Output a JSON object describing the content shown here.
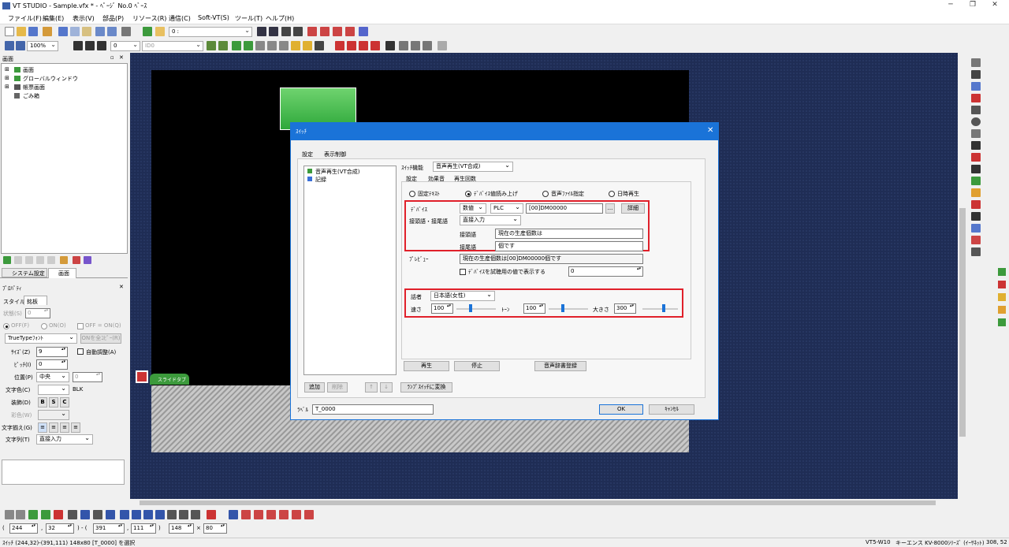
{
  "app": {
    "title": "VT STUDIO - Sample.vfx * - ﾍﾟｰｼﾞ No.0 ﾍﾞｰｽ"
  },
  "menu": [
    "ファイル(F)",
    "編集(E)",
    "表示(V)",
    "部品(P)",
    "リソース(R)",
    "通信(C)",
    "Soft-VT(S)",
    "ツール(T)",
    "ヘルプ(H)"
  ],
  "toolbar": {
    "page_combo": "0 :",
    "zoom": "100%",
    "zoom_combo2": "0",
    "id_combo": "ID0"
  },
  "screen_panel": {
    "title": "画面",
    "tree": [
      "画面",
      "グローバルウィンドウ",
      "帳票画面",
      "ごみ箱"
    ],
    "tabs": [
      "システム設定",
      "画面"
    ]
  },
  "property_panel": {
    "title": "ﾌﾟﾛﾊﾟﾃｨ",
    "tabs": [
      "スタイル",
      "銘板"
    ],
    "state_label": "状態(S)",
    "state_value": "0",
    "radio_off": "OFF(F)",
    "radio_on": "ON(O)",
    "check_off_on": "OFF = ON(Q)",
    "font_combo": "TrueTypeﾌｫﾝﾄ",
    "on_copy_btn": "ONを全ｺﾋﾟｰ(R)",
    "size_label": "ｻｲｽﾞ(Z)",
    "size_value": "9",
    "auto_adjust": "自動調整(A)",
    "pitch_label": "ﾋﾟｯﾁ(I)",
    "pitch_value": "0",
    "position_label": "位置(P)",
    "position_value": "中央",
    "position_value2": "0",
    "text_color_label": "文字色(C)",
    "blk": "BLK",
    "decoration_label": "装飾(D)",
    "deco_b": "B",
    "deco_s": "S",
    "deco_c": "C",
    "color_label": "彩色(W)",
    "align_label": "文字揃え(G)",
    "text_row_label": "文字列(T)",
    "text_row_value": "直接入力"
  },
  "canvas": {
    "slide_tab": "スライドタブ"
  },
  "dialog": {
    "title": "ｽｲｯﾁ",
    "tabs": [
      "設定",
      "表示制御"
    ],
    "function_list": [
      "音声再生(VT合成)",
      "記録"
    ],
    "add_btn": "追加",
    "delete_btn": "削除",
    "up_btn": "↑",
    "down_btn": "↓",
    "lamp_convert_btn": "ﾗﾝﾌﾟｽｲｯﾁに変換",
    "label_label": "ﾗﾍﾞﾙ",
    "label_value": "T_0000",
    "ok": "OK",
    "cancel": "ｷｬﾝｾﾙ",
    "switch_func_label": "ｽｲｯﾁ機能",
    "switch_func_value": "音声再生(VT合成)",
    "sub_tabs": [
      "設定",
      "効果音",
      "再生回数"
    ],
    "radios": [
      "固定ﾃｷｽﾄ",
      "ﾃﾞﾊﾞｲｽ値読み上げ",
      "音声ﾌｧｲﾙ指定",
      "日時再生"
    ],
    "device_label": "ﾃﾞﾊﾞｲｽ",
    "device_type": "数値",
    "device_plc": "PLC",
    "device_addr": "[00]DM00000",
    "device_more": "...",
    "detail_btn": "詳細",
    "prefix_suffix_label": "接頭語・接尾語",
    "prefix_suffix_mode": "直接入力",
    "prefix_label": "接頭語",
    "prefix_value": "現在の生産個数は",
    "suffix_label": "接尾語",
    "suffix_value": "個です",
    "preview_label": "ﾌﾟﾚﾋﾞｭｰ",
    "preview_value": "現在の生産個数は[00]DM00000個です",
    "trial_check": "ﾃﾞﾊﾞｲｽを試聴用の値で表示する",
    "trial_value": "0",
    "speaker_label": "話者",
    "speaker_value": "日本語(女性)",
    "speed_label": "速さ",
    "speed_value": "100",
    "tone_label": "ﾄｰﾝ",
    "tone_value": "100",
    "volume_label": "大きさ",
    "volume_value": "300",
    "speed_level": 0.35,
    "tone_level": 0.35,
    "volume_level": 0.6,
    "play_btn": "再生",
    "stop_btn": "停止",
    "dict_btn": "音声辞書登録"
  },
  "coords": {
    "x1": "244",
    "y1": "32",
    "x2": "391",
    "y2": "111",
    "w": "148",
    "h": "80"
  },
  "status": {
    "left": "ｽｲｯﾁ (244,32)-(391,111) 148x80 [T_0000] を選択",
    "model": "VT5-W10",
    "plc": "キーエンス KV-8000ｼﾘｰｽﾞ (ｲｰｻﾈｯﾄ)",
    "pos": "308, 52"
  },
  "colors": {
    "accent": "#1a73d8",
    "highlight": "#e0202a",
    "switch_green": "#3cb44b"
  }
}
